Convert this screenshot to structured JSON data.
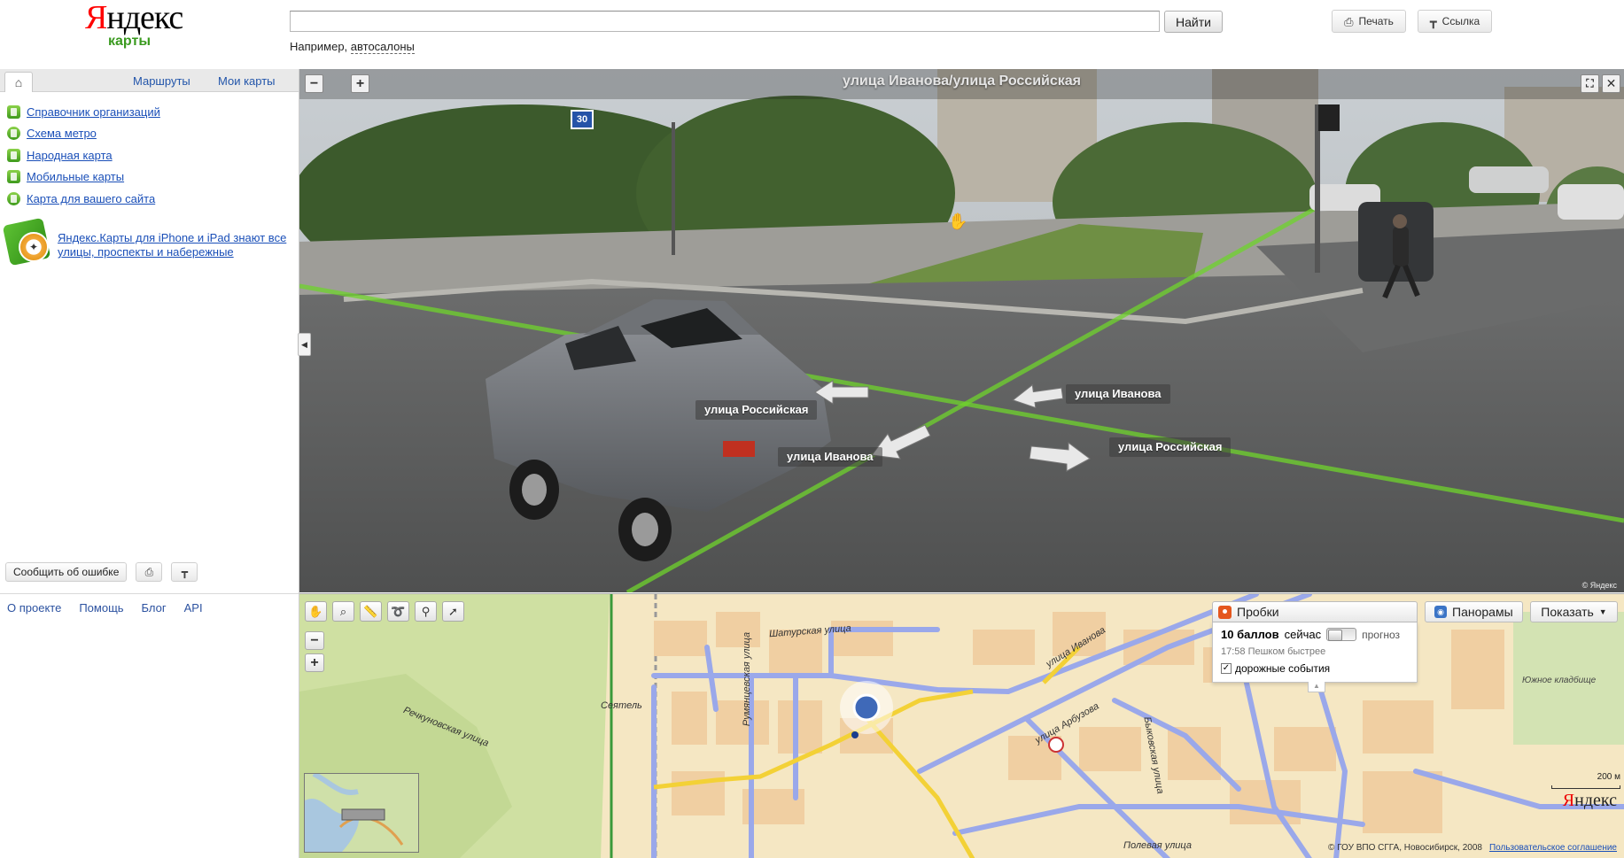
{
  "logo": {
    "word": "Яндекс",
    "first_letter": "Я",
    "rest": "ндекс",
    "sub": "карты"
  },
  "search": {
    "value": "",
    "placeholder": "",
    "button": "Найти",
    "example_prefix": "Например,",
    "example_link": "автосалоны"
  },
  "header_buttons": {
    "print": "Печать",
    "link": "Ссылка"
  },
  "sidebar": {
    "tabs": {
      "routes": "Маршруты",
      "my_maps": "Мои карты"
    },
    "menu": [
      {
        "label": "Справочник организаций",
        "icon": "directory-icon"
      },
      {
        "label": "Схема метро",
        "icon": "metro-icon"
      },
      {
        "label": "Народная карта",
        "icon": "people-map-icon"
      },
      {
        "label": "Мобильные карты",
        "icon": "mobile-icon"
      },
      {
        "label": "Карта для вашего сайта",
        "icon": "site-map-icon"
      }
    ],
    "promo_text": "Яндекс.Карты для iPhone и iPad знают все улицы, проспекты и набережные",
    "report_error": "Сообщить об ошибке",
    "footer": {
      "about": "О проекте",
      "help": "Помощь",
      "blog": "Блог",
      "api": "API"
    }
  },
  "panorama": {
    "title": "улица Иванова/улица Российская",
    "speed_sign": "30",
    "labels": [
      {
        "id": "rossiyskaya-left",
        "text": "улица Российская"
      },
      {
        "id": "ivanova-bottom",
        "text": "улица Иванова"
      },
      {
        "id": "ivanova-right",
        "text": "улица Иванова"
      },
      {
        "id": "rossiyskaya-right",
        "text": "улица Российская"
      }
    ],
    "copyright": "© Яндекс"
  },
  "map": {
    "traffic": {
      "title": "Пробки",
      "score": "10 баллов",
      "now": "сейчас",
      "forecast": "прогноз",
      "status": "17:58 Пешком быстрее",
      "events_checked": true,
      "events_label": "дорожные события"
    },
    "panoramas_button": "Панорамы",
    "show_button": "Показать",
    "cemetery": "Южное кладбище",
    "streets": {
      "shaturskaya": "Шатурская улица",
      "rechkunovskaya": "Речкуновская улица",
      "ivanova": "улица Иванова",
      "arbuzova": "улица Арбузова",
      "polevaya": "Полевая улица",
      "seyatel": "Сеятель",
      "rumyantsevskaya": "Румянцевская улица",
      "bykovskaya": "Быковская улица"
    },
    "scale_label": "200 м",
    "logo_first": "Я",
    "logo_rest": "ндекс",
    "copyright": "© ГОУ ВПО СГГА, Новосибирск, 2008",
    "agreement": "Пользовательское соглашение"
  }
}
